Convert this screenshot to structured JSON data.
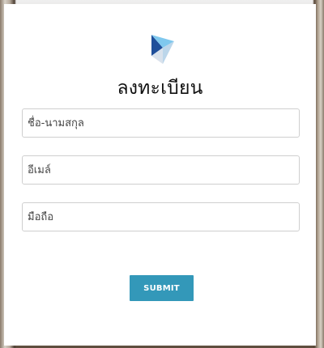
{
  "form": {
    "title": "ลงทะเบียน",
    "fields": [
      {
        "placeholder": "ชื่อ-นามสกุล",
        "value": ""
      },
      {
        "placeholder": "อีเมล์",
        "value": ""
      },
      {
        "placeholder": "มือถือ",
        "value": ""
      }
    ],
    "submit_label": "SUBMIT"
  },
  "colors": {
    "accent": "#3398b9",
    "logo_dark": "#1f4f9a",
    "logo_light": "#7fc8ee"
  },
  "icons": {
    "logo": "brand-logo-icon"
  }
}
